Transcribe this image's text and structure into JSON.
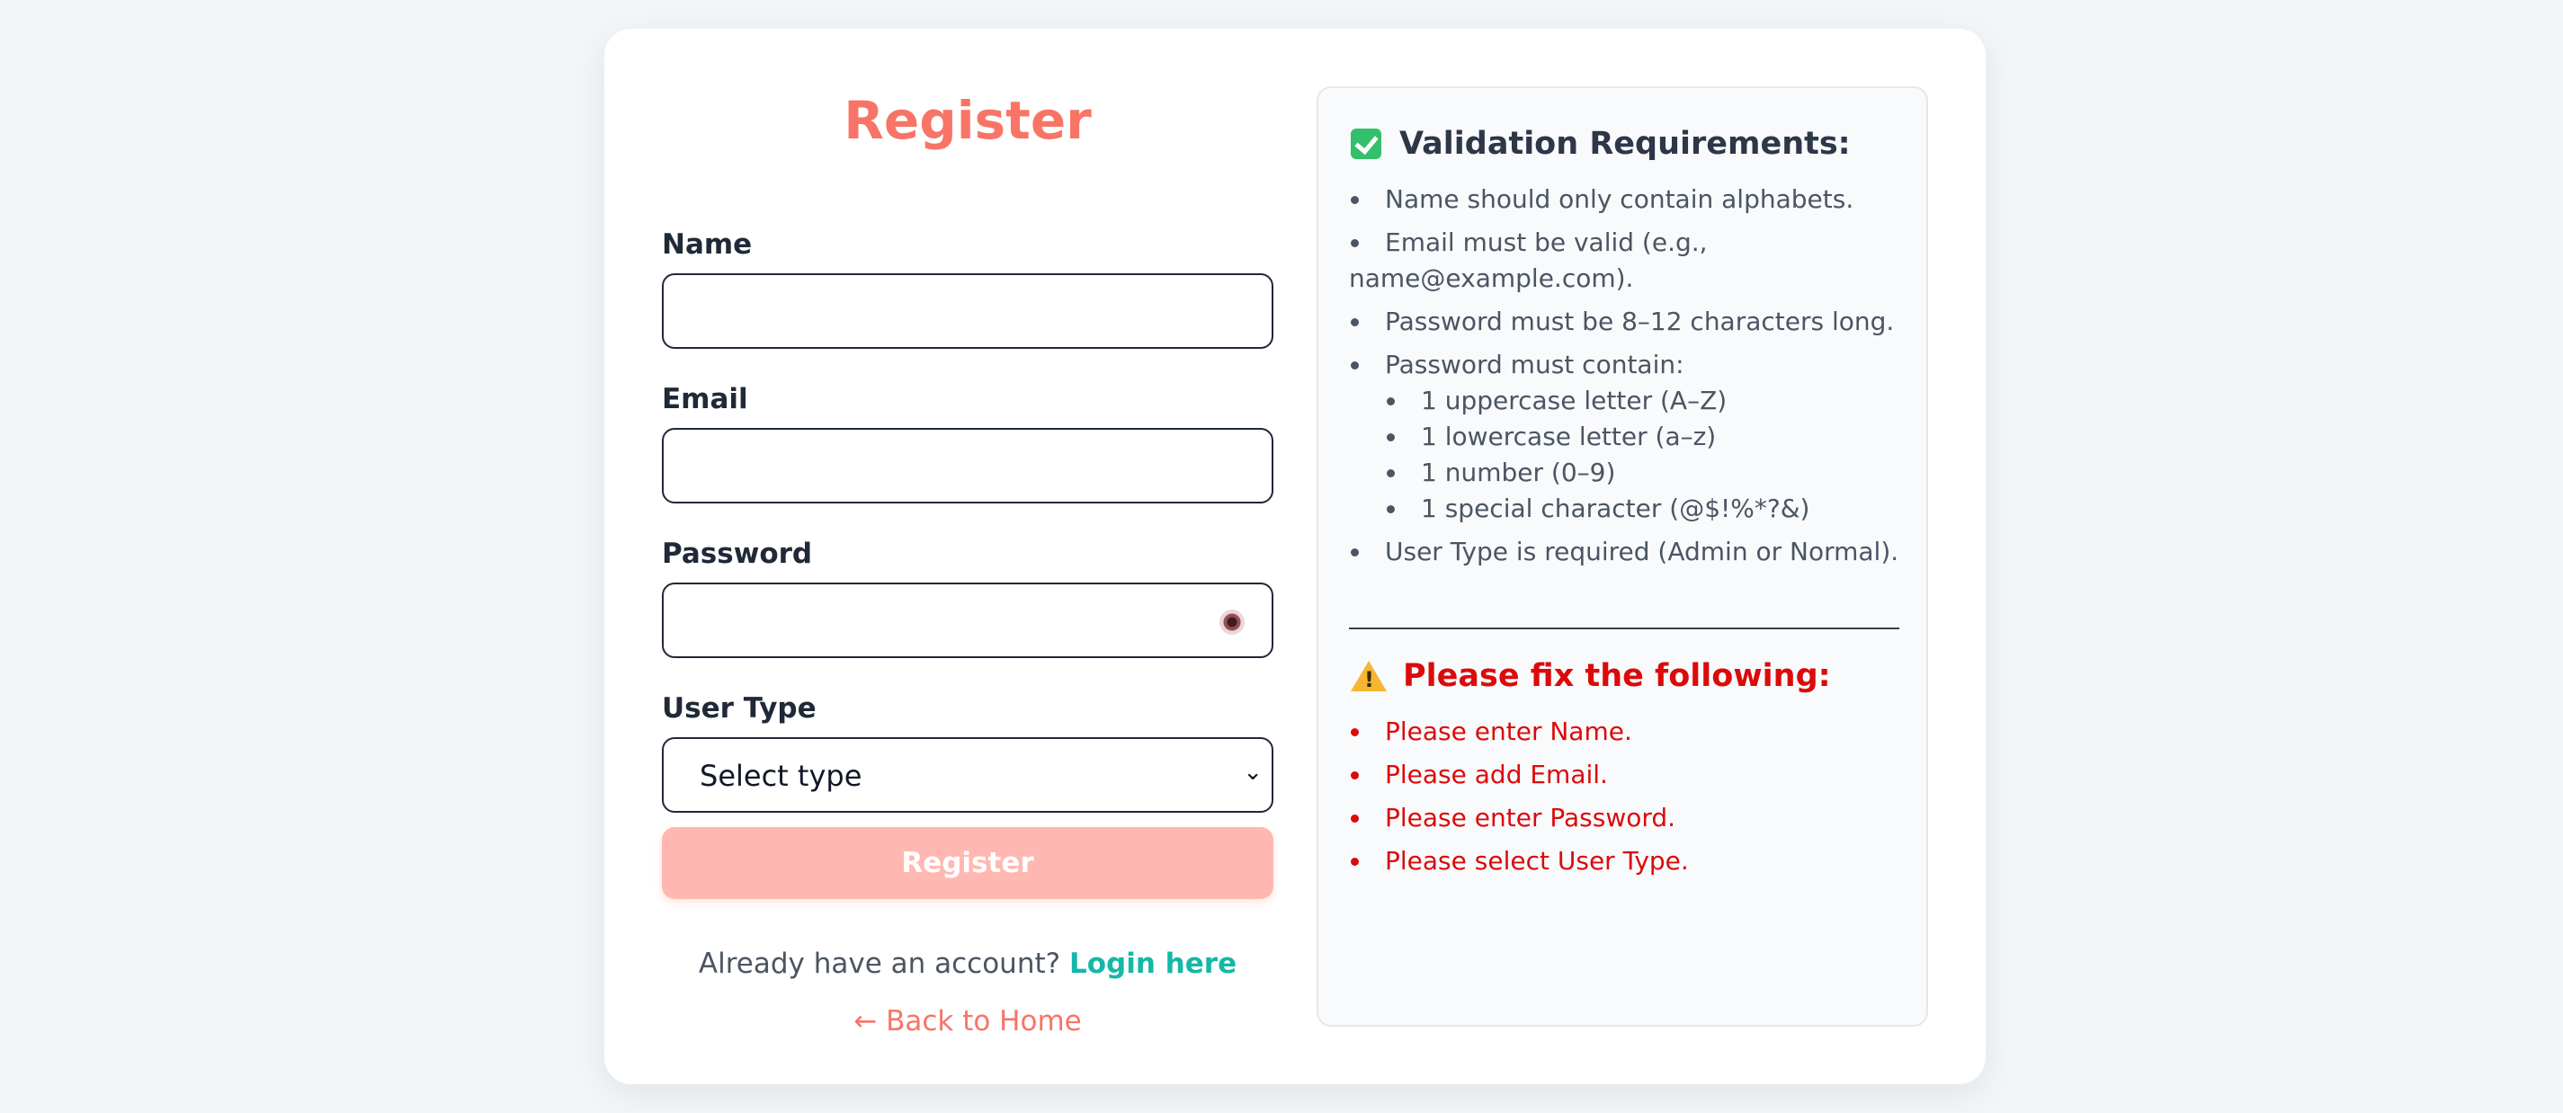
{
  "form": {
    "title": "Register",
    "name_label": "Name",
    "email_label": "Email",
    "password_label": "Password",
    "user_type_label": "User Type",
    "user_type_value": "Select type",
    "submit_label": "Register",
    "login_prompt": "Already have an account?",
    "login_link": "Login here",
    "back_link": "← Back to Home"
  },
  "requirements": {
    "heading": "Validation Requirements:",
    "items": [
      "Name should only contain alphabets.",
      "Email must be valid (e.g.,",
      "name@example.com).",
      "Password must be 8–12 characters long.",
      "Password must contain:",
      "User Type is required (Admin or Normal)."
    ],
    "sub_items": [
      "1 uppercase letter (A–Z)",
      "1 lowercase letter (a–z)",
      "1 number (0–9)",
      "1 special character (@$!%*?&)"
    ]
  },
  "errors": {
    "heading": "Please fix the following:",
    "items": [
      "Please enter Name.",
      "Please add Email.",
      "Please enter Password.",
      "Please select User Type."
    ]
  },
  "colors": {
    "accent": "#f87467",
    "link": "#14b8a6",
    "error": "#dc0a0a",
    "button_disabled": "#ffb8b1"
  },
  "icons": {
    "password_toggle": "eye-icon",
    "requirements_heading": "check-box-icon",
    "errors_heading": "warning-icon",
    "select_arrow": "chevron-down-icon"
  }
}
